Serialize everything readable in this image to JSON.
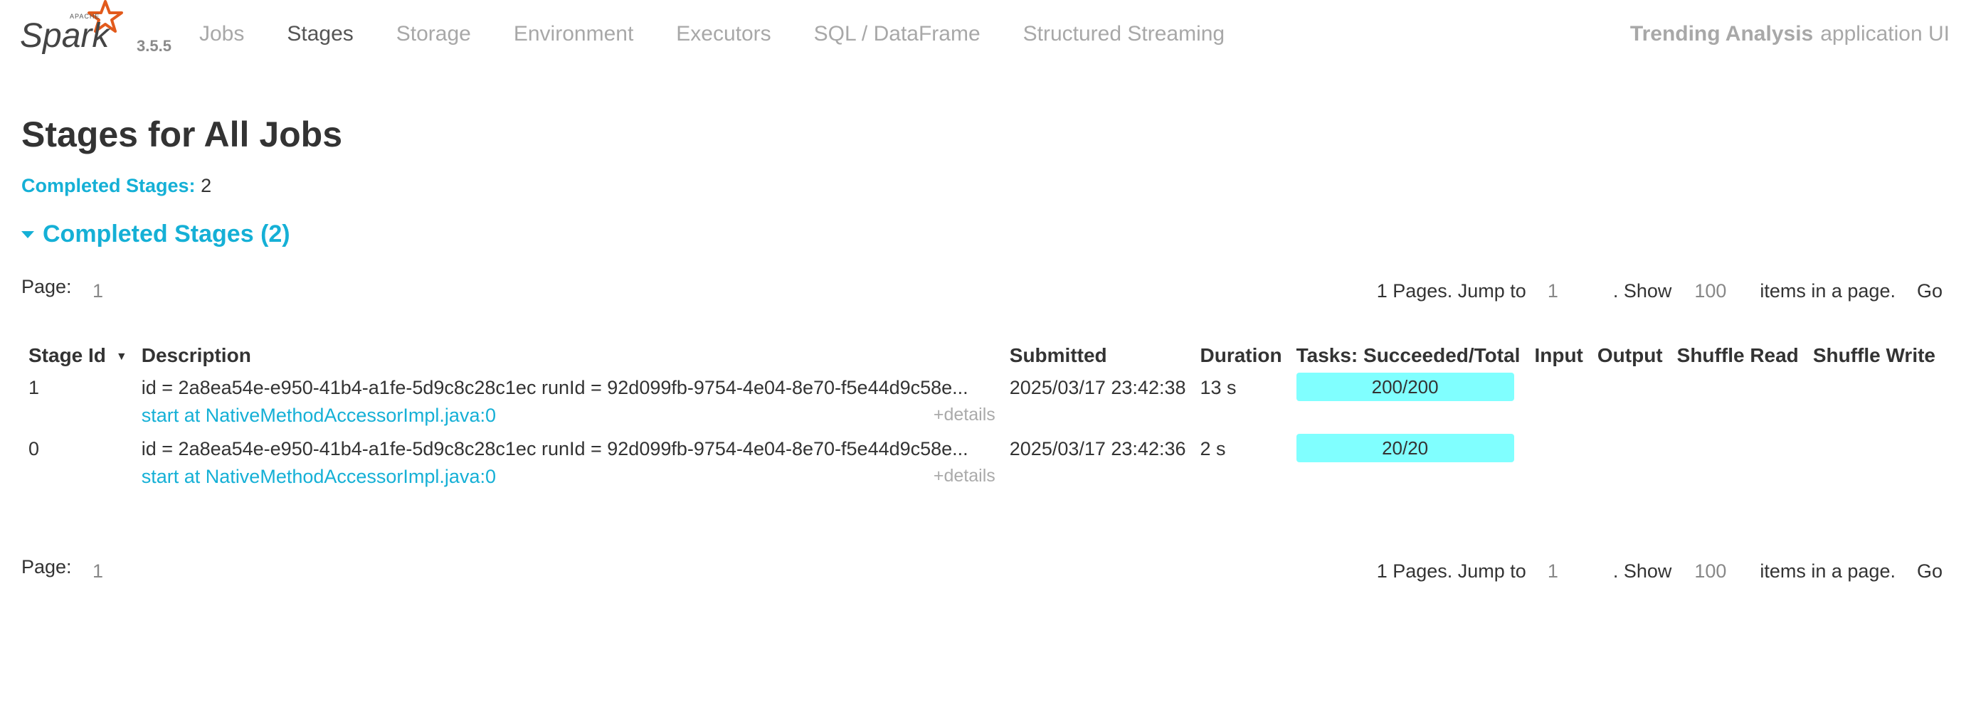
{
  "brand": {
    "logo_text": "Spark",
    "logo_small_text": "APACHE",
    "version": "3.5.5",
    "accent_color": "#e25a1c"
  },
  "nav": {
    "items": [
      {
        "label": "Jobs",
        "active": false
      },
      {
        "label": "Stages",
        "active": true
      },
      {
        "label": "Storage",
        "active": false
      },
      {
        "label": "Environment",
        "active": false
      },
      {
        "label": "Executors",
        "active": false
      },
      {
        "label": "SQL / DataFrame",
        "active": false
      },
      {
        "label": "Structured Streaming",
        "active": false
      }
    ],
    "app_name": "Trending Analysis",
    "app_suffix": "application UI"
  },
  "page": {
    "title": "Stages for All Jobs",
    "summary_label": "Completed Stages:",
    "summary_value": "2",
    "section_title": "Completed Stages (2)"
  },
  "pager": {
    "page_label": "Page:",
    "current_page": "1",
    "pages_text": "1 Pages. Jump to",
    "jump_value": "1",
    "show_text": ". Show",
    "page_size": "100",
    "items_text": "items in a page.",
    "go_label": "Go"
  },
  "table": {
    "headers": [
      "Stage Id",
      "Description",
      "Submitted",
      "Duration",
      "Tasks: Succeeded/Total",
      "Input",
      "Output",
      "Shuffle Read",
      "Shuffle Write"
    ],
    "sort_indicator": "▼",
    "rows": [
      {
        "stage_id": "1",
        "description": "id = 2a8ea54e-e950-41b4-a1fe-5d9c8c28c1ec runId = 92d099fb-9754-4e04-8e70-f5e44d9c58e...",
        "link": "start at NativeMethodAccessorImpl.java:0",
        "details": "+details",
        "submitted": "2025/03/17 23:42:38",
        "duration": "13 s",
        "tasks": "200/200",
        "tasks_progress": 1.0
      },
      {
        "stage_id": "0",
        "description": "id = 2a8ea54e-e950-41b4-a1fe-5d9c8c28c1ec runId = 92d099fb-9754-4e04-8e70-f5e44d9c58e...",
        "link": "start at NativeMethodAccessorImpl.java:0",
        "details": "+details",
        "submitted": "2025/03/17 23:42:36",
        "duration": "2 s",
        "tasks": "20/20",
        "tasks_progress": 1.0
      }
    ]
  },
  "colors": {
    "link": "#15b0d6",
    "progress_fill": "#80ffff"
  }
}
